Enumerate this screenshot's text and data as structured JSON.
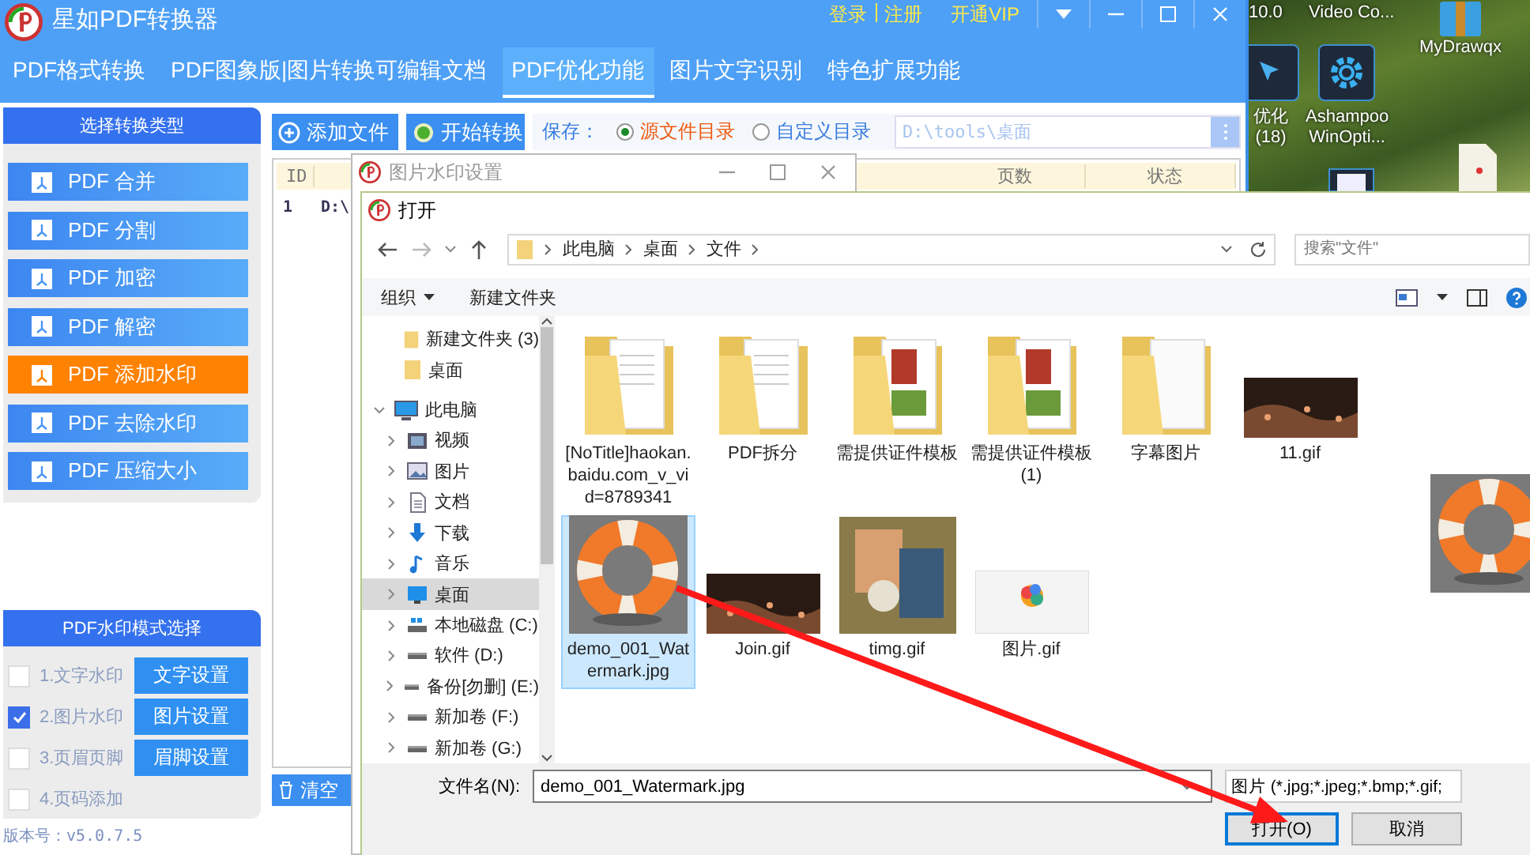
{
  "desktop": {
    "items": [
      {
        "kind": "label-only",
        "lines": [
          "10.0"
        ]
      },
      {
        "kind": "label-only",
        "lines": [
          "Video Co..."
        ]
      },
      {
        "kind": "archive",
        "lines": [
          "MyDrawqx"
        ]
      },
      {
        "kind": "cursor",
        "lines": [
          "优化",
          "(18)"
        ]
      },
      {
        "kind": "gear",
        "lines": [
          "Ashampoo",
          "WinOpti..."
        ]
      },
      {
        "kind": "document"
      },
      {
        "kind": "file"
      }
    ]
  },
  "app": {
    "title": "星如PDF转换器",
    "account_links": [
      "登录",
      "注册"
    ],
    "vip_link": "开通VIP",
    "tabs": [
      {
        "label": "PDF格式转换",
        "selected": false
      },
      {
        "label": "PDF图象版|图片转换可编辑文档",
        "selected": false
      },
      {
        "label": "PDF优化功能",
        "selected": true
      },
      {
        "label": "图片文字识别",
        "selected": false
      },
      {
        "label": "特色扩展功能",
        "selected": false
      }
    ],
    "sidebar": {
      "header": "选择转换类型",
      "items": [
        {
          "label": "PDF 合并",
          "selected": false
        },
        {
          "label": "PDF 分割",
          "selected": false
        },
        {
          "label": "PDF 加密",
          "selected": false
        },
        {
          "label": "PDF 解密",
          "selected": false
        },
        {
          "label": "PDF 添加水印",
          "selected": true
        },
        {
          "label": "PDF 去除水印",
          "selected": false
        },
        {
          "label": "PDF 压缩大小",
          "selected": false
        }
      ]
    },
    "watermark_mode": {
      "header": "PDF水印模式选择",
      "options": [
        {
          "label": "1.文字水印",
          "checked": false,
          "button": "文字设置"
        },
        {
          "label": "2.图片水印",
          "checked": true,
          "button": "图片设置"
        },
        {
          "label": "3.页眉页脚",
          "checked": false,
          "button": "眉脚设置"
        },
        {
          "label": "4.页码添加",
          "checked": false
        }
      ]
    },
    "version": "版本号：v5.0.7.5",
    "toolbar": {
      "add_button": "添加文件",
      "start_button": "开始转换",
      "save_label": "保存：",
      "save_options": [
        {
          "label": "源文件目录",
          "selected": true
        },
        {
          "label": "自定义目录",
          "selected": false
        }
      ],
      "path": "D:\\tools\\桌面"
    },
    "table": {
      "columns": [
        "ID",
        "页数",
        "状态"
      ],
      "rows": [
        [
          "1",
          "D:\\"
        ]
      ]
    },
    "clear_button": "清空"
  },
  "watermark_dialog": {
    "title": "图片水印设置"
  },
  "open_dialog": {
    "title": "打开",
    "breadcrumb": [
      "此电脑",
      "桌面",
      "文件"
    ],
    "search": {
      "placeholder": "搜索\"文件\""
    },
    "organize": "组织",
    "new_folder": "新建文件夹",
    "quick_access": [
      {
        "label": "新建文件夹 (3)",
        "selected": false
      },
      {
        "label": "桌面",
        "selected": false
      }
    ],
    "this_pc": {
      "label": "此电脑",
      "expanded": true,
      "children": [
        {
          "label": "视频",
          "kind": "video",
          "expanded": false,
          "selected": false
        },
        {
          "label": "图片",
          "kind": "pictures",
          "expanded": false,
          "selected": false
        },
        {
          "label": "文档",
          "kind": "documents",
          "expanded": false,
          "selected": false
        },
        {
          "label": "下载",
          "kind": "download",
          "expanded": false,
          "selected": false
        },
        {
          "label": "音乐",
          "kind": "music",
          "expanded": false,
          "selected": false
        },
        {
          "label": "桌面",
          "kind": "desktop",
          "expanded": false,
          "selected": true
        },
        {
          "label": "本地磁盘 (C:)",
          "kind": "system-drive",
          "expanded": false,
          "selected": false
        },
        {
          "label": "软件 (D:)",
          "kind": "drive",
          "expanded": false,
          "selected": false
        },
        {
          "label": "备份[勿删] (E:)",
          "kind": "drive",
          "expanded": false,
          "selected": false
        },
        {
          "label": "新加卷 (F:)",
          "kind": "drive",
          "expanded": false,
          "selected": false
        },
        {
          "label": "新加卷 (G:)",
          "kind": "drive",
          "expanded": false,
          "selected": false
        }
      ]
    },
    "files": [
      {
        "name": "[NoTitle]haokan.baidu.com_v_vid=8789341",
        "kind": "folder-docs",
        "selected": false
      },
      {
        "name": "PDF拆分",
        "kind": "folder-docs",
        "selected": false
      },
      {
        "name": "需提供证件模板",
        "kind": "folder-photos",
        "selected": false
      },
      {
        "name": "需提供证件模板(1)",
        "kind": "folder-photos",
        "selected": false
      },
      {
        "name": "字幕图片",
        "kind": "folder",
        "selected": false
      },
      {
        "name": "11.gif",
        "kind": "fireworks",
        "selected": false
      },
      {
        "name": "demo_001_Watermark.jpg",
        "kind": "lifebuoy",
        "selected": true
      },
      {
        "name": "Join.gif",
        "kind": "fireworks",
        "selected": false
      },
      {
        "name": "timg.gif",
        "kind": "illustration",
        "selected": false
      },
      {
        "name": "图片.gif",
        "kind": "app-logo",
        "selected": false
      }
    ],
    "filename_label": "文件名(N):",
    "filename": "demo_001_Watermark.jpg",
    "filter": "图片 (*.jpg;*.jpeg;*.bmp;*.gif;",
    "open_button": "打开(O)",
    "cancel_button": "取消"
  }
}
